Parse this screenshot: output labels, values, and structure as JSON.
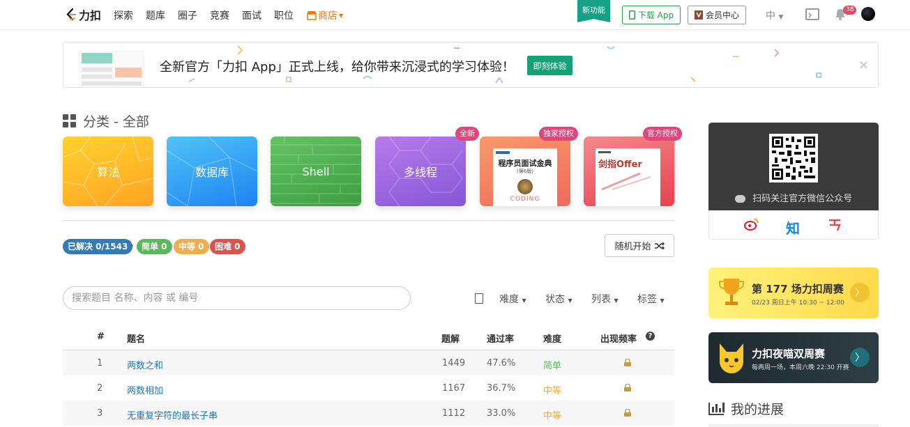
{
  "nav": {
    "logo_text": "力扣",
    "items": [
      "探索",
      "题库",
      "圈子",
      "竞赛",
      "面试",
      "职位"
    ],
    "shop": "商店",
    "new_feature": "新功能",
    "download": "下载 App",
    "member": "会员中心",
    "lang": "中",
    "notifications": "38"
  },
  "banner": {
    "text": "全新官方「力扣 App」正式上线，给你带来沉浸式的学习体验！",
    "button": "即刻体验",
    "close": "×"
  },
  "categories": {
    "title": "分类 - 全部",
    "cards": [
      {
        "label": "算法",
        "badge": ""
      },
      {
        "label": "数据库",
        "badge": ""
      },
      {
        "label": "Shell",
        "badge": ""
      },
      {
        "label": "多线程",
        "badge": "全新"
      },
      {
        "label": "程序员面试金典",
        "badge": "独家授权",
        "sub": "(第6版)",
        "bottom": "CODING"
      },
      {
        "label": "剑指Offer",
        "badge": "官方授权"
      }
    ]
  },
  "stats": {
    "solved": "已解决 0/1543",
    "separator": "-",
    "easy": "简单 0",
    "medium": "中等 0",
    "hard": "困难 0",
    "random": "随机开始"
  },
  "search": {
    "placeholder": "搜索题目 名称、内容 或 编号"
  },
  "filters": [
    "难度",
    "状态",
    "列表",
    "标签"
  ],
  "table": {
    "headers": [
      "#",
      "题名",
      "题解",
      "通过率",
      "难度",
      "出现频率"
    ],
    "rows": [
      {
        "id": "1",
        "title": "两数之和",
        "solutions": "1449",
        "rate": "47.6%",
        "difficulty": "简单"
      },
      {
        "id": "2",
        "title": "两数相加",
        "solutions": "1167",
        "rate": "36.7%",
        "difficulty": "中等"
      },
      {
        "id": "3",
        "title": "无重复字符的最长子串",
        "solutions": "1112",
        "rate": "33.0%",
        "difficulty": "中等"
      }
    ]
  },
  "sidebar": {
    "qr_text": "扫码关注官方微信公众号",
    "social": [
      "weibo-icon",
      "zhihu-icon",
      "toutiao-icon"
    ],
    "zhihu": "知",
    "contest1": {
      "title": "第 177 场力扣周赛",
      "sub": "02/23 周日上午 10:30 ~ 12:00"
    },
    "contest2": {
      "title": "力扣夜喵双周赛",
      "sub": "每两周一场，本周六晚 22:30 开赛"
    },
    "progress": "我的进展"
  },
  "colors": {
    "brand_green": "#15a176",
    "easy": "#5cb85c",
    "medium": "#f0ad4e",
    "hard": "#d9534f",
    "solved": "#337ab7",
    "link": "#1a7ab8"
  }
}
